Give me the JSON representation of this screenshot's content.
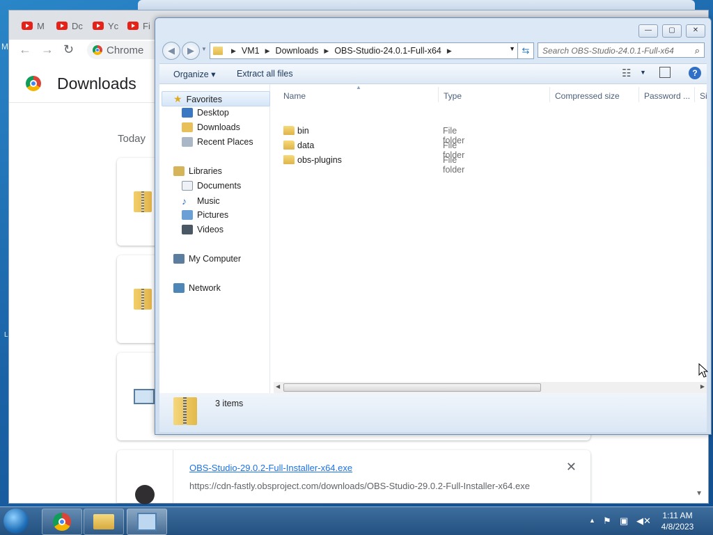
{
  "desktop": {
    "left_glyph_1": "M",
    "left_glyph_2": "L"
  },
  "chrome": {
    "tabs": [
      "M",
      "Dc",
      "Yc",
      "Fi"
    ],
    "omnibox_text": "Chrome",
    "page_title": "Downloads",
    "section_today": "Today",
    "download": {
      "link": "OBS-Studio-29.0.2-Full-Installer-x64.exe",
      "url": "https://cdn-fastly.obsproject.com/downloads/OBS-Studio-29.0.2-Full-Installer-x64.exe",
      "close": "✕"
    }
  },
  "explorer": {
    "window_buttons": {
      "minimize": "—",
      "maximize": "▢",
      "close": "✕"
    },
    "breadcrumb": [
      "VM1",
      "Downloads",
      "OBS-Studio-24.0.1-Full-x64"
    ],
    "search_placeholder": "Search OBS-Studio-24.0.1-Full-x64",
    "commands": {
      "organize": "Organize",
      "extract": "Extract all files"
    },
    "nav": {
      "favorites": "Favorites",
      "desktop": "Desktop",
      "downloads": "Downloads",
      "recent": "Recent Places",
      "libraries": "Libraries",
      "documents": "Documents",
      "music": "Music",
      "pictures": "Pictures",
      "videos": "Videos",
      "computer": "My Computer",
      "network": "Network"
    },
    "columns": {
      "name": "Name",
      "type": "Type",
      "compressed": "Compressed size",
      "password": "Password ...",
      "size": "Si"
    },
    "files": [
      {
        "name": "bin",
        "type": "File folder"
      },
      {
        "name": "data",
        "type": "File folder"
      },
      {
        "name": "obs-plugins",
        "type": "File folder"
      }
    ],
    "item_count": "3 items"
  },
  "taskbar": {
    "time": "1:11 AM",
    "date": "4/8/2023"
  }
}
